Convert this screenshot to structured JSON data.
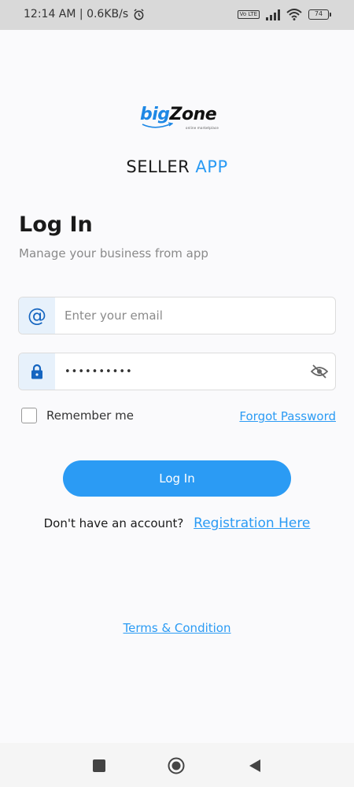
{
  "status_bar": {
    "time_speed": "12:14 AM | 0.6KB/s",
    "battery_level": "74",
    "network_badge": "Vo LTE",
    "icons": [
      "alarm-icon",
      "volte-icon",
      "signal-icon",
      "wifi-icon",
      "battery-icon"
    ]
  },
  "logo": {
    "big": "big",
    "zone": "Zone",
    "tagline": "online marketplace"
  },
  "app_title": {
    "seller": "SELLER",
    "app": "APP"
  },
  "login": {
    "heading": "Log In",
    "subtitle": "Manage your business from app",
    "email_placeholder": "Enter your email",
    "email_value": "",
    "password_value": "••••••••••",
    "remember_label": "Remember me",
    "forgot_label": "Forgot Password",
    "button_label": "Log In",
    "signup_prompt": "Don't have an account?",
    "signup_link": "Registration Here",
    "terms_label": "Terms & Condition"
  },
  "colors": {
    "accent": "#2b9bf4",
    "icon_bg": "#e7f1fb",
    "brand_blue": "#1e88e5"
  },
  "nav": {
    "icons": [
      "recent-apps-icon",
      "home-icon",
      "back-icon"
    ]
  }
}
